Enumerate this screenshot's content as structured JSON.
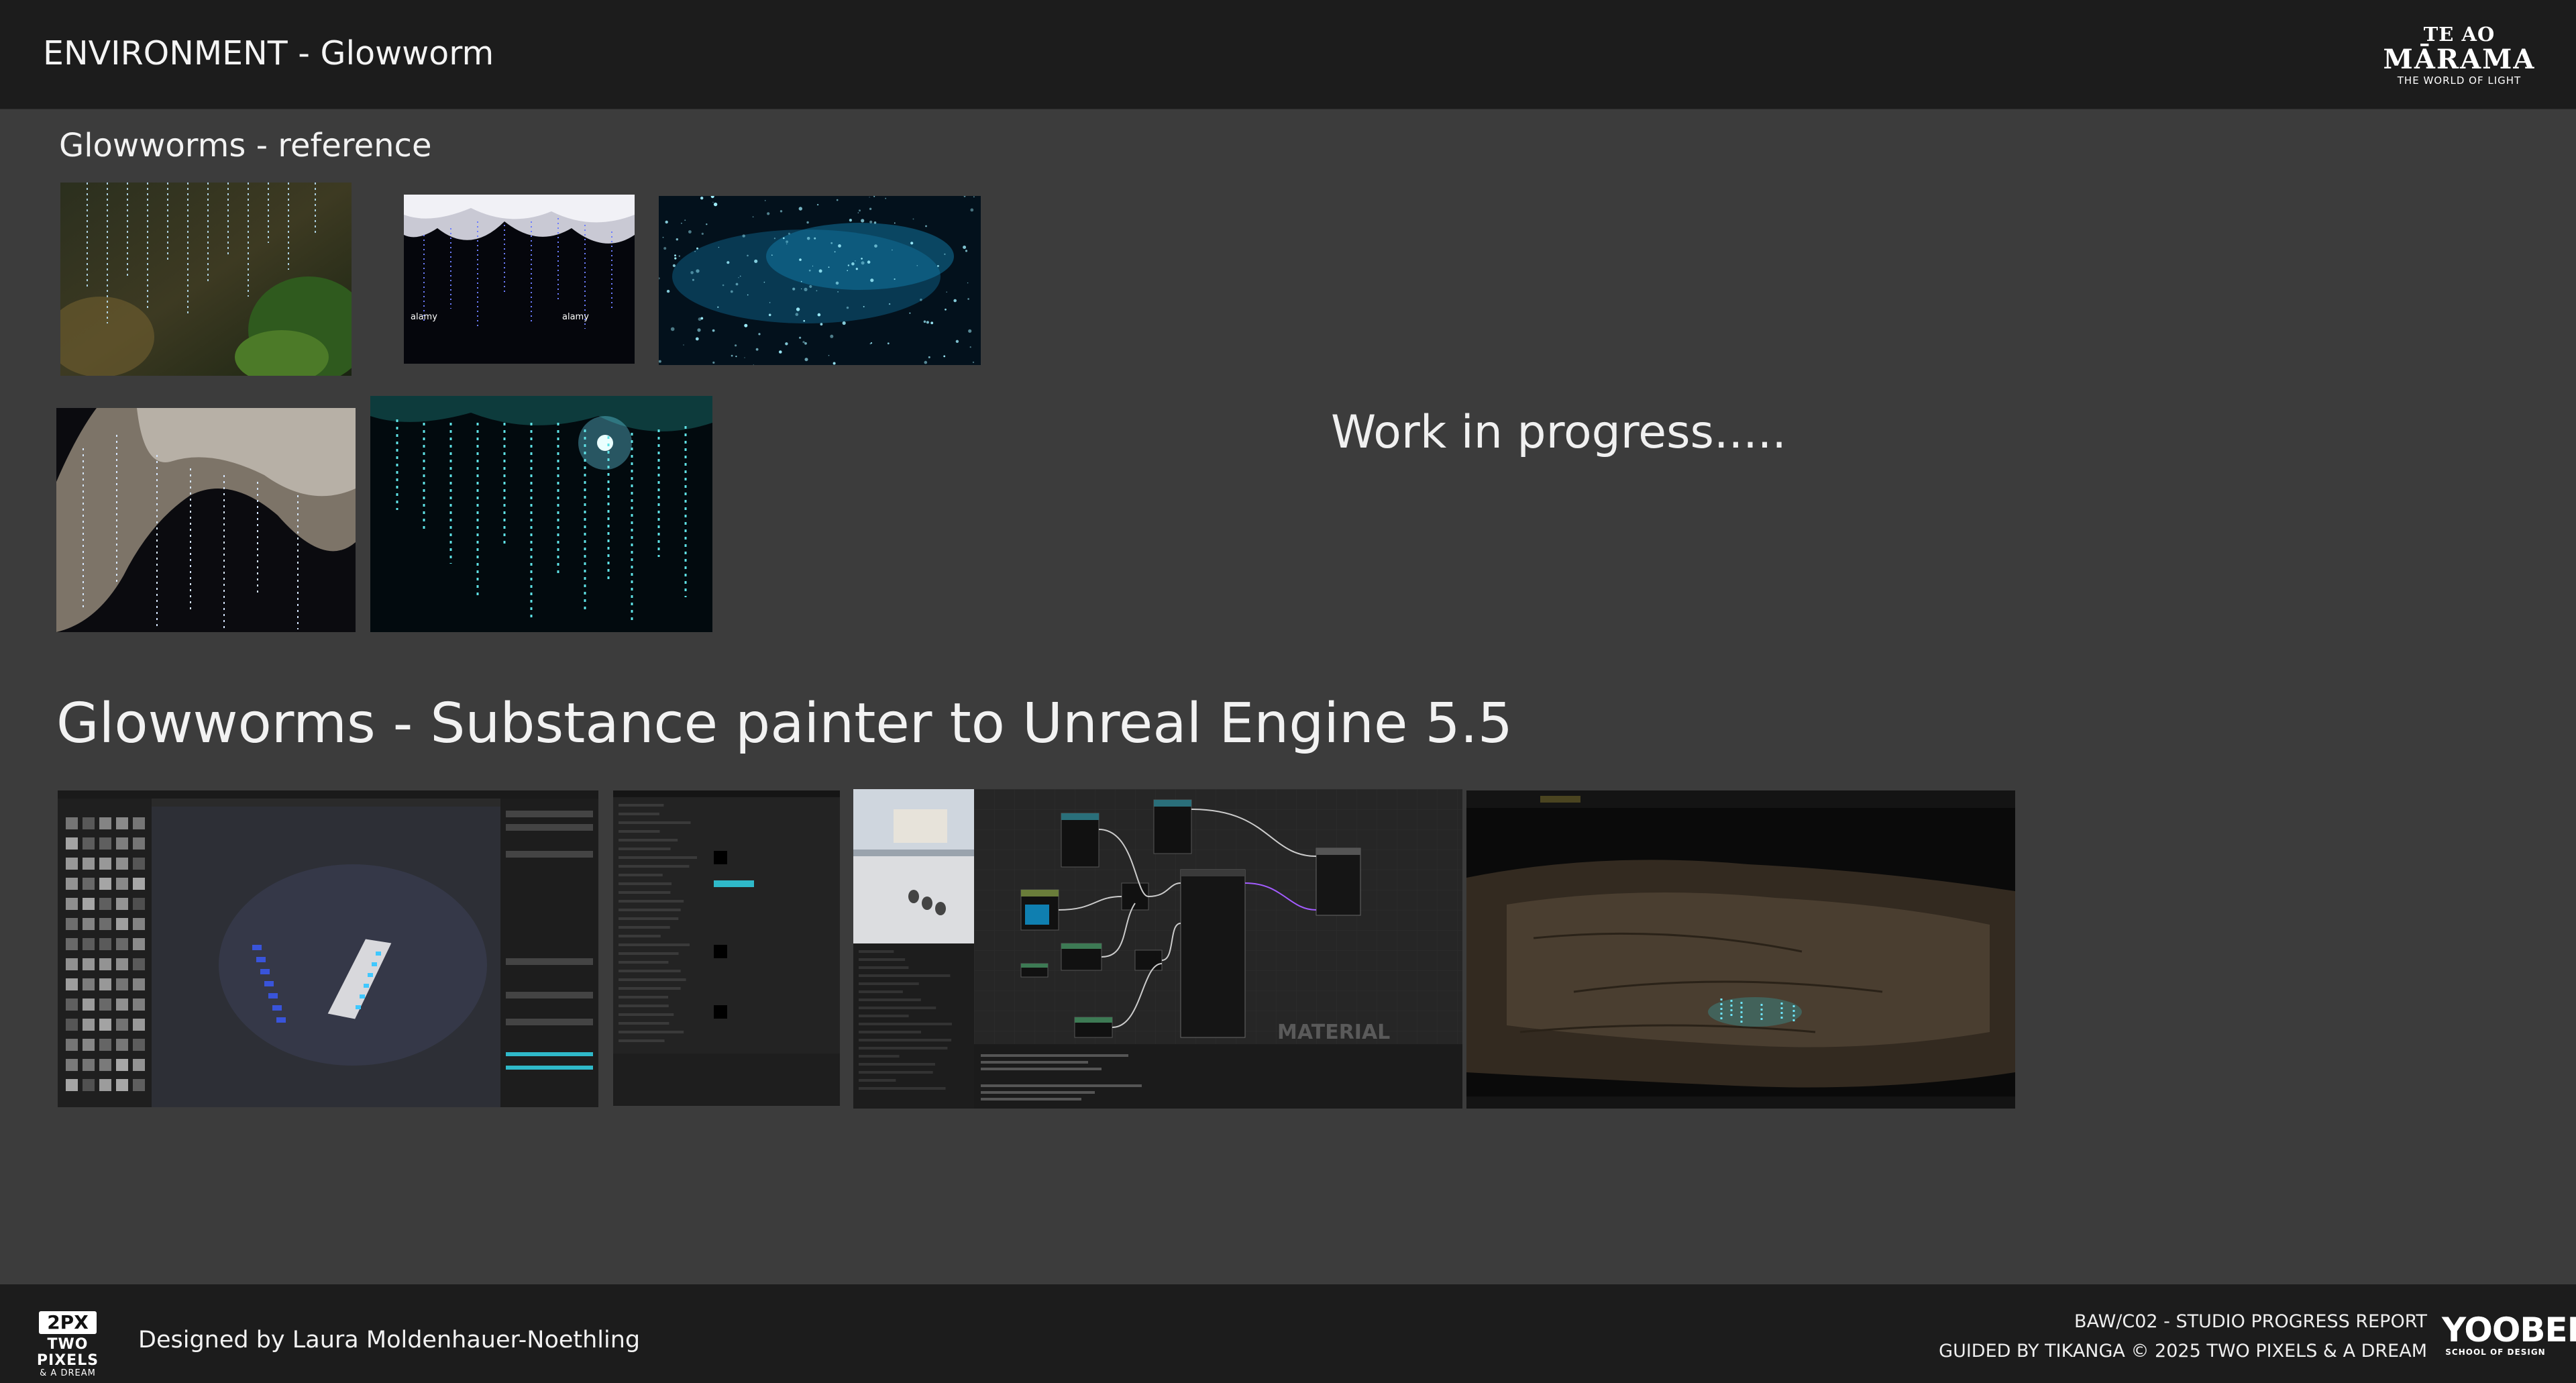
{
  "header": {
    "title": "ENVIRONMENT - Glowworm",
    "logo": {
      "line1": "TE AO",
      "line2": "MĀRAMA",
      "line3": "THE WORLD OF LIGHT"
    }
  },
  "reference": {
    "title": "Glowworms - reference",
    "images": [
      {
        "name": "glowworm-threads-foliage-photo"
      },
      {
        "name": "glowworm-cave-stock-photo",
        "watermark": "alamy"
      },
      {
        "name": "glowworm-starfield-photo"
      },
      {
        "name": "glowworm-threads-rock-photo"
      },
      {
        "name": "glowworm-teal-threads-photo"
      }
    ]
  },
  "wip_text": "Work in progress.....",
  "substance": {
    "title": "Glowworms - Substance painter to Unreal Engine 5.5",
    "screens": [
      {
        "name": "substance-painter-screenshot"
      },
      {
        "name": "material-details-panel-screenshot"
      },
      {
        "name": "unreal-material-graph-screenshot",
        "label": "MATERIAL"
      },
      {
        "name": "unreal-viewport-screenshot"
      }
    ]
  },
  "footer": {
    "logo": {
      "badge": "2PX",
      "line2": "TWO PIXELS",
      "line3": "& A DREAM"
    },
    "designer": "Designed by Laura Moldenhauer-Noethling",
    "report_line1": "BAW/C02 - STUDIO PROGRESS REPORT",
    "report_line2": "GUIDED BY TIKANGA © 2025 TWO PIXELS & A DREAM",
    "school_logo": {
      "name": "YOOBEE",
      "tagline": "SCHOOL OF DESIGN"
    }
  },
  "colors": {
    "background": "#3c3c3c",
    "header_bg": "#1c1c1c",
    "glow": "#6fe6ff",
    "node_purple": "#a35cff"
  }
}
